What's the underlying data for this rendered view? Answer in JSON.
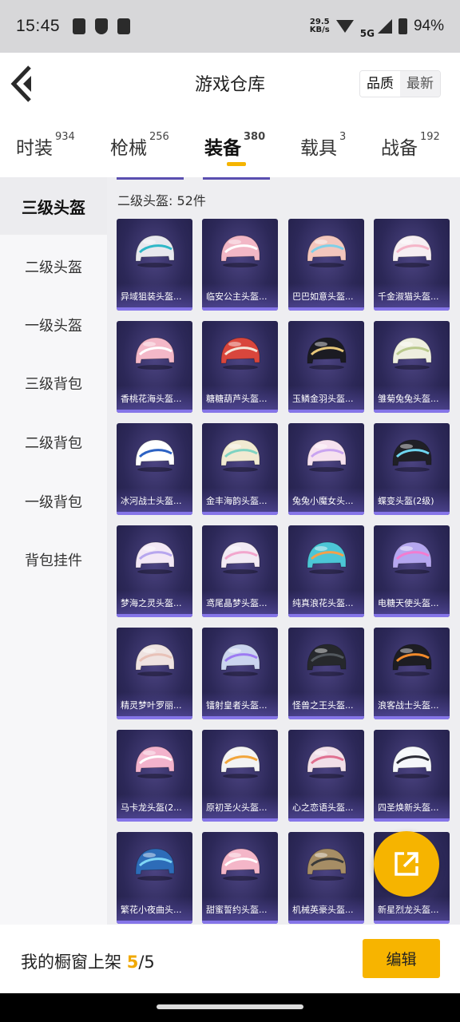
{
  "status": {
    "time": "15:45",
    "net_speed_top": "29.5",
    "net_speed_bottom": "KB/s",
    "network": "5G",
    "battery": "94%"
  },
  "header": {
    "title": "游戏仓库",
    "sort_quality": "品质",
    "sort_latest": "最新"
  },
  "tabs": [
    {
      "label": "时装",
      "count": "934"
    },
    {
      "label": "枪械",
      "count": "256"
    },
    {
      "label": "装备",
      "count": "380"
    },
    {
      "label": "载具",
      "count": "3"
    },
    {
      "label": "战备",
      "count": "192"
    }
  ],
  "sidebar": [
    {
      "label": "三级头盔"
    },
    {
      "label": "二级头盔"
    },
    {
      "label": "一级头盔"
    },
    {
      "label": "三级背包"
    },
    {
      "label": "二级背包"
    },
    {
      "label": "一级背包"
    },
    {
      "label": "背包挂件"
    }
  ],
  "section": {
    "title": "二级头盔: 52件"
  },
  "items": [
    {
      "name": "异域狙装头盔...",
      "color": "#e8e8ee",
      "accent": "#2fb8c8"
    },
    {
      "name": "临安公主头盔...",
      "color": "#f2b7c6",
      "accent": "#ffffff"
    },
    {
      "name": "巴巴如意头盔...",
      "color": "#f3c6bd",
      "accent": "#7fd0e8"
    },
    {
      "name": "千金淑猫头盔...",
      "color": "#f6eef2",
      "accent": "#f5b5c8"
    },
    {
      "name": "香桃花海头盔...",
      "color": "#f4b8c8",
      "accent": "#ffffff"
    },
    {
      "name": "糖糖葫芦头盔...",
      "color": "#d9463c",
      "accent": "#f3e6d8"
    },
    {
      "name": "玉鳞金羽头盔...",
      "color": "#1b1b22",
      "accent": "#e7c77a"
    },
    {
      "name": "雏菊兔兔头盔...",
      "color": "#eeefdf",
      "accent": "#b9c98c"
    },
    {
      "name": "冰河战士头盔...",
      "color": "#ffffff",
      "accent": "#2c62c4"
    },
    {
      "name": "金丰海韵头盔...",
      "color": "#f1ead2",
      "accent": "#7fd3c2"
    },
    {
      "name": "兔兔小魔女头...",
      "color": "#f6e1ef",
      "accent": "#c9a4f0"
    },
    {
      "name": "蝶变头盔(2级)",
      "color": "#202026",
      "accent": "#6fd6f0"
    },
    {
      "name": "梦海之灵头盔...",
      "color": "#f3e8f6",
      "accent": "#b7a6ee"
    },
    {
      "name": "鸢尾晶梦头盔...",
      "color": "#f2eaf4",
      "accent": "#f2a6cd"
    },
    {
      "name": "纯真浪花头盔...",
      "color": "#4cc6d6",
      "accent": "#f4a04a"
    },
    {
      "name": "电糖天使头盔...",
      "color": "#b5a7f0",
      "accent": "#f27cd0"
    },
    {
      "name": "精灵梦叶罗丽...",
      "color": "#efe3e1",
      "accent": "#e8c2b8"
    },
    {
      "name": "镭射皇者头盔...",
      "color": "#cbd5ef",
      "accent": "#9d7bf2"
    },
    {
      "name": "怪兽之王头盔...",
      "color": "#26282c",
      "accent": "#52585e"
    },
    {
      "name": "浪客战士头盔...",
      "color": "#1d1d22",
      "accent": "#f28a2a"
    },
    {
      "name": "马卡龙头盔(2...",
      "color": "#f3b3cc",
      "accent": "#ffffff"
    },
    {
      "name": "原初圣火头盔...",
      "color": "#f3f3f3",
      "accent": "#f2a53a"
    },
    {
      "name": "心之恋语头盔...",
      "color": "#f1dfe8",
      "accent": "#e07090"
    },
    {
      "name": "四圣焕新头盔...",
      "color": "#f5f7fa",
      "accent": "#2b2b35"
    },
    {
      "name": "繁花小夜曲头...",
      "color": "#2d6cb8",
      "accent": "#7fd6f5"
    },
    {
      "name": "甜蜜誓约头盔...",
      "color": "#f4b6c8",
      "accent": "#ffffff"
    },
    {
      "name": "机械英豪头盔...",
      "color": "#a68d65",
      "accent": "#3a3a3a"
    },
    {
      "name": "新星烈龙头盔...",
      "color": "#e6e6ea",
      "accent": "#e03b3b"
    }
  ],
  "footer": {
    "label": "我的橱窗上架 ",
    "count": "5",
    "total": "/5",
    "edit": "编辑"
  },
  "icons": {
    "back": "back-arrow-icon",
    "fab": "share-external-icon"
  }
}
